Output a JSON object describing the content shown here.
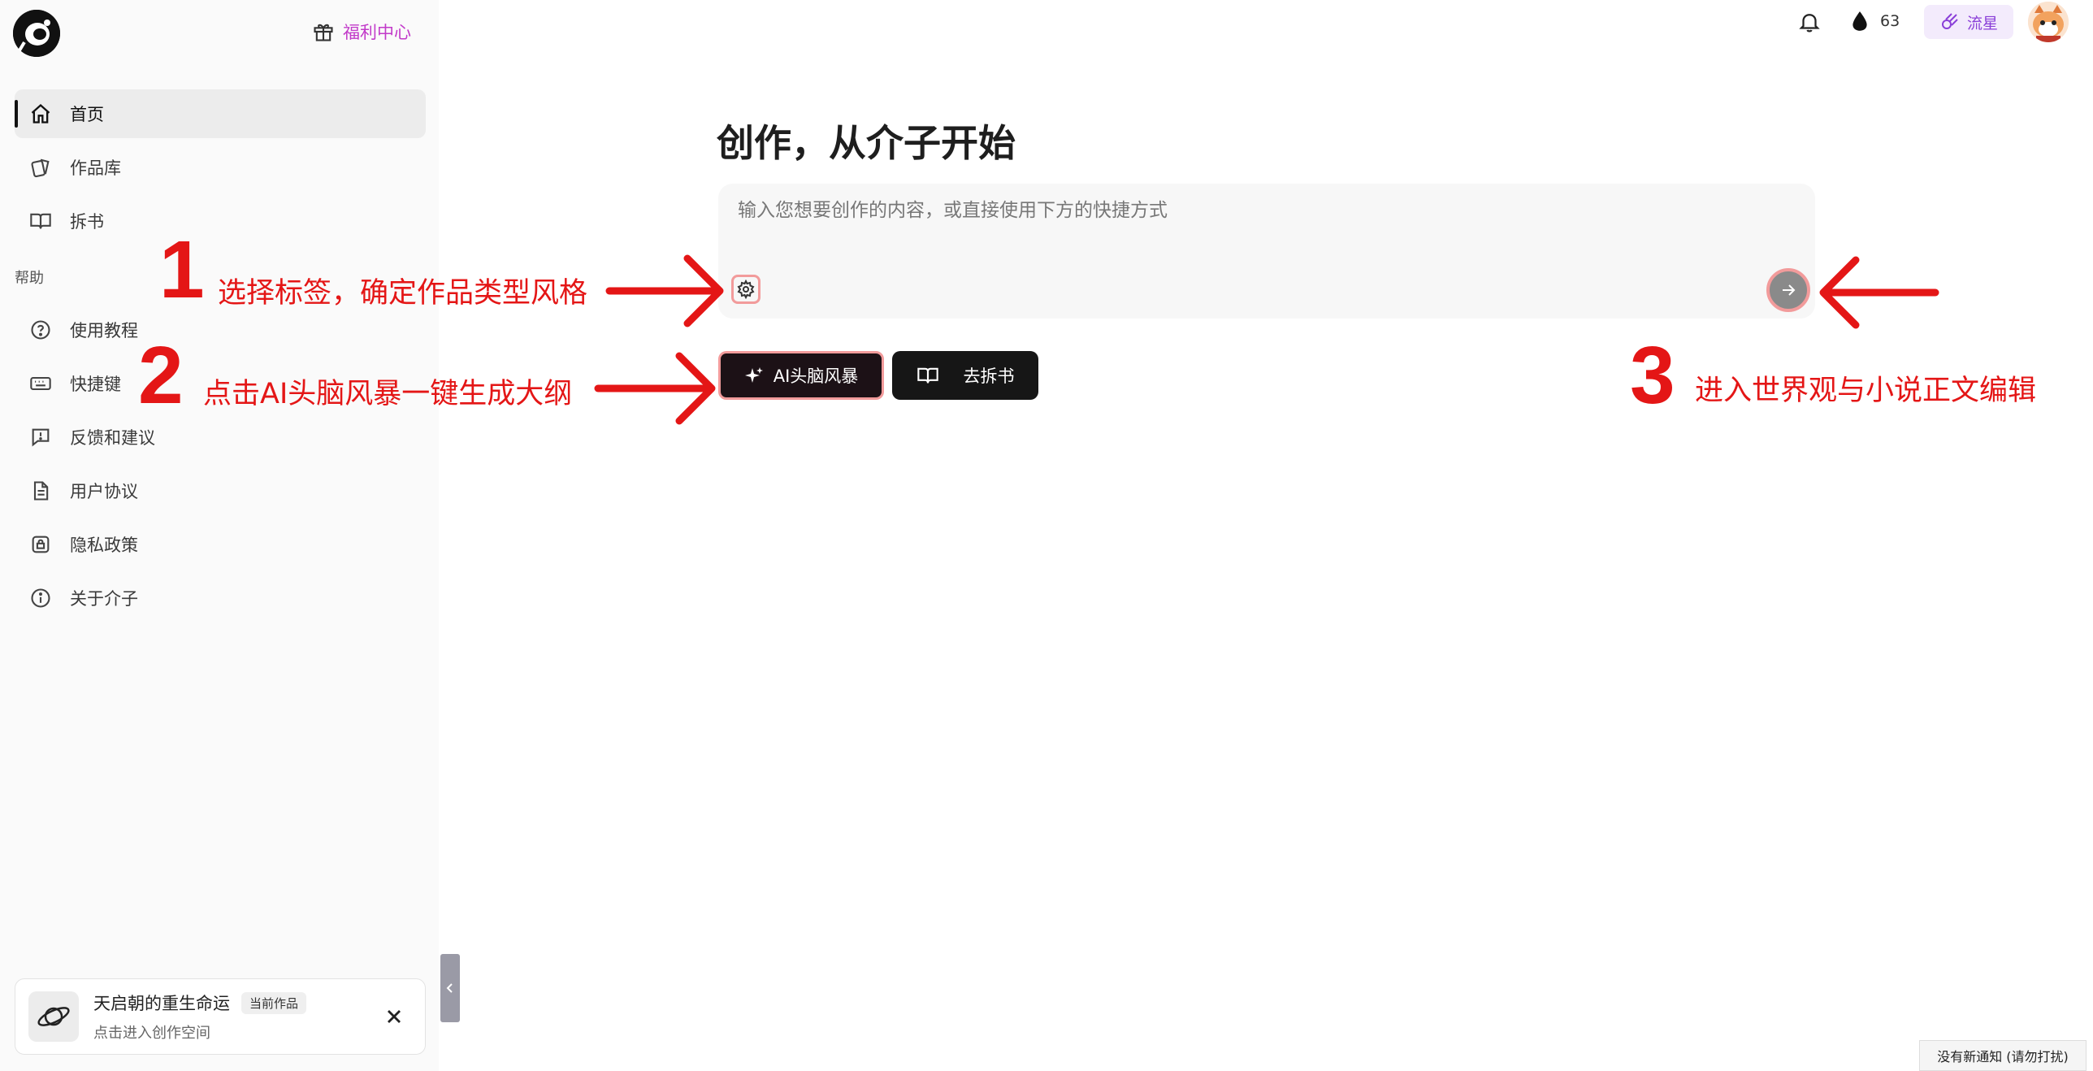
{
  "sidebar": {
    "gift_label": "福利中心",
    "nav": [
      {
        "label": "首页",
        "icon": "home-icon"
      },
      {
        "label": "作品库",
        "icon": "cards-icon"
      },
      {
        "label": "拆书",
        "icon": "book-open-icon"
      }
    ],
    "help_title": "帮助",
    "help_items": [
      {
        "label": "使用教程",
        "icon": "question-icon"
      },
      {
        "label": "快捷键",
        "icon": "keyboard-icon"
      },
      {
        "label": "反馈和建议",
        "icon": "feedback-icon"
      },
      {
        "label": "用户协议",
        "icon": "document-icon"
      },
      {
        "label": "隐私政策",
        "icon": "lock-icon"
      },
      {
        "label": "关于介子",
        "icon": "info-icon"
      }
    ],
    "current_work": {
      "title": "天启朝的重生命运",
      "badge": "当前作品",
      "subtitle": "点击进入创作空间"
    }
  },
  "topbar": {
    "drop_count": "63",
    "meteor_label": "流星"
  },
  "main": {
    "title": "创作，从介子开始",
    "composer_placeholder": "输入您想要创作的内容，或直接使用下方的快捷方式",
    "ai_button": "AI头脑风暴",
    "split_button": "去拆书"
  },
  "annotations": [
    {
      "number": "1",
      "text": "选择标签，确定作品类型风格"
    },
    {
      "number": "2",
      "text": "点击AI头脑风暴一键生成大纲"
    },
    {
      "number": "3",
      "text": "进入世界观与小说正文编辑"
    }
  ],
  "colors": {
    "annotation": "#e41616",
    "accent_purple": "#8a3fd8",
    "gift_pink": "#c23ac9"
  },
  "toast": "没有新通知 (请勿打扰)"
}
